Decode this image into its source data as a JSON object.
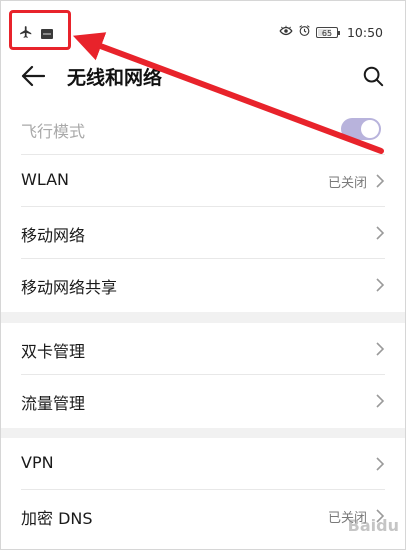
{
  "status_bar": {
    "time": "10:50",
    "battery_level": "65",
    "icons": [
      "airplane-icon",
      "sim-card-icon",
      "eye-comfort-icon",
      "alarm-icon",
      "battery-icon"
    ]
  },
  "app_bar": {
    "title": "无线和网络",
    "back_icon": "back-arrow-icon",
    "search_icon": "search-icon"
  },
  "sections": [
    {
      "items": [
        {
          "label": "飞行模式",
          "type": "toggle",
          "on": true,
          "disabled": true
        },
        {
          "label": "WLAN",
          "value": "已关闭"
        },
        {
          "label": "移动网络"
        },
        {
          "label": "移动网络共享"
        }
      ]
    },
    {
      "items": [
        {
          "label": "双卡管理"
        },
        {
          "label": "流量管理"
        }
      ]
    },
    {
      "items": [
        {
          "label": "VPN"
        },
        {
          "label": "加密 DNS",
          "value": "已关闭"
        }
      ]
    }
  ],
  "watermark": "Baidu",
  "colors": {
    "annotation_red": "#e8232b",
    "toggle_on_disabled": "#b8b3dc",
    "background": "#f1f1f1"
  }
}
